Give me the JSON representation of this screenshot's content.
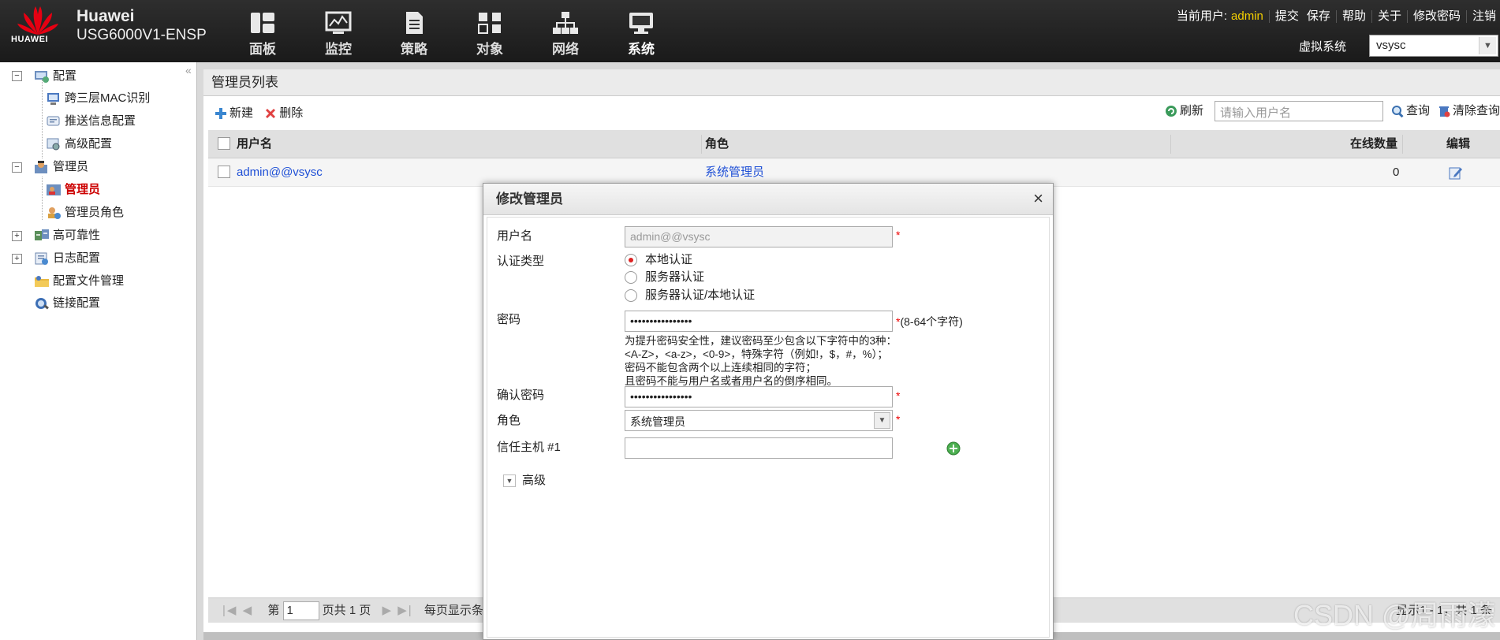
{
  "header": {
    "logo_text": "HUAWEI",
    "brand": "Huawei",
    "model": "USG6000V1-ENSP",
    "nav": [
      {
        "label": "面板",
        "icon": "dashboard-icon"
      },
      {
        "label": "监控",
        "icon": "monitor-icon"
      },
      {
        "label": "策略",
        "icon": "policy-icon"
      },
      {
        "label": "对象",
        "icon": "object-icon"
      },
      {
        "label": "网络",
        "icon": "network-icon"
      },
      {
        "label": "系统",
        "icon": "system-icon"
      }
    ],
    "current_user_label": "当前用户:",
    "current_user": "admin",
    "links": [
      "提交",
      "保存",
      "帮助",
      "关于",
      "修改密码",
      "注销"
    ],
    "vsys_label": "虚拟系统",
    "vsys_value": "vsysc",
    "accent_color": "#f5d000"
  },
  "sidebar": {
    "collapse_glyph": "«",
    "items": [
      {
        "label": "配置",
        "expand": "−"
      },
      {
        "label": "跨三层MAC识别"
      },
      {
        "label": "推送信息配置"
      },
      {
        "label": "高级配置"
      },
      {
        "label": "管理员",
        "expand": "−"
      },
      {
        "label": "管理员"
      },
      {
        "label": "管理员角色"
      },
      {
        "label": "高可靠性",
        "expand": "+"
      },
      {
        "label": "日志配置",
        "expand": "+"
      },
      {
        "label": "配置文件管理"
      },
      {
        "label": "链接配置"
      }
    ]
  },
  "main": {
    "title": "管理员列表",
    "toolbar": {
      "new": "新建",
      "delete": "删除",
      "refresh": "刷新",
      "search_placeholder": "请输入用户名",
      "query": "查询",
      "clear": "清除查询"
    },
    "columns": [
      "用户名",
      "角色",
      "在线数量",
      "编辑"
    ],
    "rows": [
      {
        "username": "admin@@vsysc",
        "role": "系统管理员",
        "online": "0"
      }
    ],
    "pager": {
      "prefix": "第",
      "page": "1",
      "total": "页共 1 页",
      "per_page": "每页显示条",
      "right": "显示1 - 1，共 1 条"
    }
  },
  "dialog": {
    "title": "修改管理员",
    "close": "×",
    "username_label": "用户名",
    "username_value": "admin@@vsysc",
    "auth_label": "认证类型",
    "auth_options": [
      "本地认证",
      "服务器认证",
      "服务器认证/本地认证"
    ],
    "password_label": "密码",
    "password_value": "••••••••••••••••",
    "password_hint": "(8-64个字符)",
    "password_rules": [
      "为提升密码安全性，建议密码至少包含以下字符中的3种：",
      "<A-Z>，<a-z>，<0-9>，特殊字符（例如!，$，#，%）；",
      "密码不能包含两个以上连续相同的字符；",
      "且密码不能与用户名或者用户名的倒序相同。"
    ],
    "confirm_label": "确认密码",
    "confirm_value": "••••••••••••••••",
    "role_label": "角色",
    "role_value": "系统管理员",
    "trust_label": "信任主机 #1",
    "advanced_label": "高级",
    "required_mark": "*"
  },
  "watermark": "CSDN @周雨濛"
}
